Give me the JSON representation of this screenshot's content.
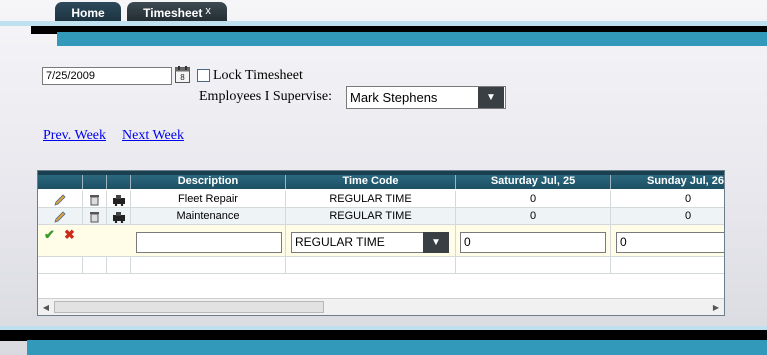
{
  "tabs": [
    {
      "label": "Home"
    },
    {
      "label": "Timesheet",
      "close": "x"
    }
  ],
  "form": {
    "date_value": "7/25/2009",
    "lock_label": "Lock Timesheet",
    "supervise_label": "Employees I Supervise:",
    "employee_value": "Mark Stephens"
  },
  "nav": {
    "prev": "Prev. Week",
    "next": "Next Week"
  },
  "grid": {
    "columns": [
      "Description",
      "Time Code",
      "Saturday Jul, 25",
      "Sunday Jul, 26"
    ],
    "rows": [
      {
        "description": "Fleet Repair",
        "time_code": "REGULAR TIME",
        "sat": "0",
        "sun": "0"
      },
      {
        "description": "Maintenance",
        "time_code": "REGULAR TIME",
        "sat": "0",
        "sun": "0"
      }
    ],
    "edit_row": {
      "description": "",
      "time_code": "REGULAR TIME",
      "sat": "0",
      "sun": "0"
    }
  },
  "colors": {
    "accent_blue": "#3399bb",
    "header_teal": "#1c4f63",
    "tab_dark": "#20292f"
  }
}
